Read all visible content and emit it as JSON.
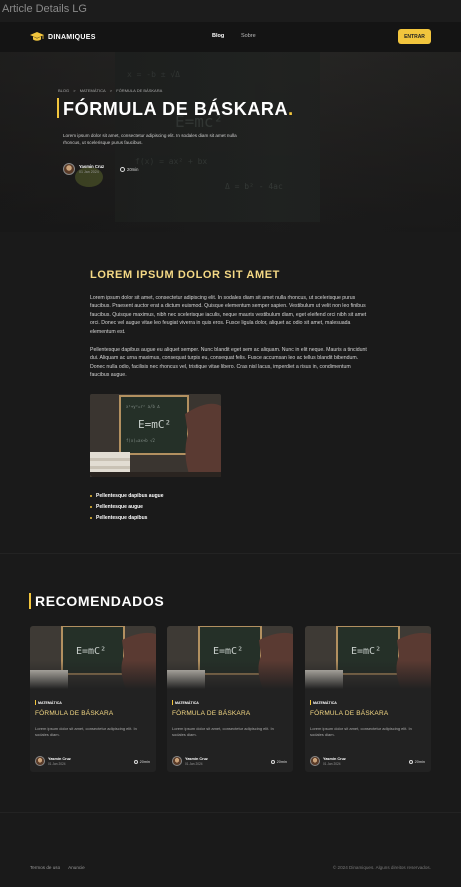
{
  "window": {
    "title": "Article Details LG"
  },
  "header": {
    "logo_text": "DINAMIQUES",
    "nav": [
      {
        "label": "Blog"
      },
      {
        "label": "Sobre"
      }
    ],
    "cta_label": "ENTRAR"
  },
  "hero": {
    "breadcrumbs": [
      "BLOG",
      ">",
      "MATEMÁTICA",
      ">",
      "FÓRMULA DE BÁSKARA"
    ],
    "title": "FÓRMULA DE BÁSKARA",
    "title_dot": ".",
    "description": "Lorem ipsum dolor sit amet, consectetur adipiscing elit. In sodales diam sit amet nulla rhoncus, ut scelerisque purus faucibus.",
    "author": {
      "name": "Yasmin Cruz",
      "date": "01 Jan 2024"
    },
    "read_time": "20min"
  },
  "article": {
    "heading": "LOREM IPSUM DOLOR SIT AMET",
    "paragraphs": [
      "Lorem ipsum dolor sit amet, consectetur adipiscing elit. In sodales diam sit amet nulla rhoncus, ut scelerisque purus faucibus. Praesent auctor erat a dictum euismod. Quisque elementum semper sapien. Vestibulum ut velit non leo finibus faucibus. Quisque maximus, nibh nec scelerisque iaculis, neque mauris vestibulum diam, eget eleifend orci nibh sit amet orci. Donec vel augue vitae leo feugiat viverra in quis eros. Fusce ligula dolor, aliquet ac odio sit amet, malesuada elementum est.",
      "Pellentesque dapibus augue eu aliquet semper. Nunc blandit eget sem ac aliquam. Nunc in elit neque. Mauris a tincidunt dui. Aliquam ac urna maximus, consequat turpis eu, consequat felis. Fusce accumsan leo ac tellus blandit bibendum. Donec nulla odio, facilisis nec rhoncus vel, tristique vitae libero. Cras nisl lacus, imperdiet a risus in, condimentum faucibus augue."
    ],
    "bullets": [
      "Pellentesque dapibus augue",
      "Pellentesque augue",
      "Pellentesque dapibus"
    ]
  },
  "recommended": {
    "title": "RECOMENDADOS",
    "cards": [
      {
        "tag": "MATEMÁTICA",
        "title": "FÓRMULA DE BÁSKARA",
        "desc": "Lorem ipsum dolor sit amet, consectetur adipiscing elit. In sodales diam.",
        "author": "Yasmin Cruz",
        "date": "01 Jan 2024",
        "read_time": "20min"
      },
      {
        "tag": "MATEMÁTICA",
        "title": "FÓRMULA DE BÁSKARA",
        "desc": "Lorem ipsum dolor sit amet, consectetur adipiscing elit. In sodales diam.",
        "author": "Yasmin Cruz",
        "date": "01 Jan 2024",
        "read_time": "20min"
      },
      {
        "tag": "MATEMÁTICA",
        "title": "FÓRMULA DE BÁSKARA",
        "desc": "Lorem ipsum dolor sit amet, consectetur adipiscing elit. In sodales diam.",
        "author": "Yasmin Cruz",
        "date": "01 Jan 2024",
        "read_time": "20min"
      }
    ]
  },
  "footer": {
    "links": [
      "Termos de uso",
      "Anuncie"
    ],
    "copyright": "© 2024 Dinamiques. Alguns direitos reservados."
  },
  "colors": {
    "accent": "#f2c53d",
    "heading_gold": "#f5d985",
    "background": "#1a1a1a"
  },
  "icons": [
    "graduation-cap-icon",
    "clock-icon"
  ]
}
